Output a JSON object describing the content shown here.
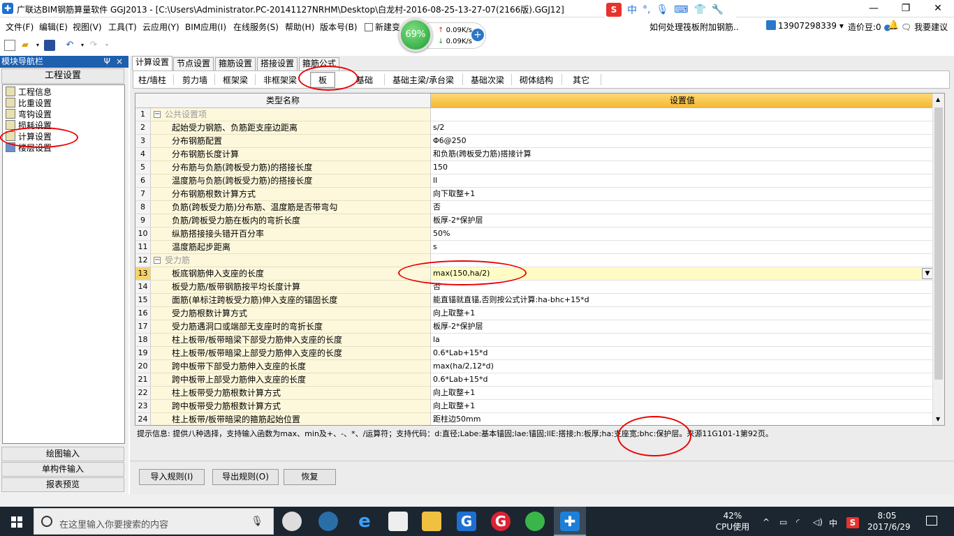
{
  "window": {
    "title": "广联达BIM钢筋算量软件 GGJ2013 - [C:\\Users\\Administrator.PC-20141127NRHM\\Desktop\\白龙村-2016-08-25-13-27-07(2166版).GGJ12]",
    "minimize": "—",
    "restore": "❐",
    "close": "✕"
  },
  "ime_bar": {
    "logo": "S",
    "mode": "中",
    "punct": "°,",
    "voice": "🎙",
    "keyboard": "⌨",
    "skin": "👕",
    "tools": "🔧"
  },
  "menu": [
    "文件(F)",
    "编辑(E)",
    "视图(V)",
    "工具(T)",
    "云应用(Y)",
    "BIM应用(I)",
    "在线服务(S)",
    "帮助(H)",
    "版本号(B)",
    "新建变"
  ],
  "news_link": "如何处理筏板附加钢筋..",
  "user": {
    "phone": "13907298339",
    "beans_label": "造价豆:0",
    "suggest": "我要建议"
  },
  "net_monitor": {
    "percent": "69%",
    "up": "0.09K/s",
    "down": "0.09K/s",
    "plus": "+"
  },
  "left_nav": {
    "header": "模块导航栏",
    "pin": "Ψ",
    "close": "×",
    "section": "工程设置",
    "items": [
      "工程信息",
      "比重设置",
      "弯钩设置",
      "损耗设置",
      "计算设置",
      "楼层设置"
    ],
    "bottom": [
      "绘图输入",
      "单构件输入",
      "报表预览"
    ]
  },
  "tabs": [
    "计算设置",
    "节点设置",
    "箍筋设置",
    "搭接设置",
    "箍筋公式"
  ],
  "subtabs": [
    "柱/墙柱",
    "剪力墙",
    "框架梁",
    "非框架梁",
    "板",
    "基础",
    "基础主梁/承台梁",
    "基础次梁",
    "砌体结构",
    "其它"
  ],
  "grid": {
    "col_name": "类型名称",
    "col_value": "设置值",
    "rows": [
      {
        "no": "1",
        "name": "公共设置项",
        "value": "",
        "group": true
      },
      {
        "no": "2",
        "name": "起始受力钢筋、负筋距支座边距离",
        "value": "s/2"
      },
      {
        "no": "3",
        "name": "分布钢筋配置",
        "value": "Φ6@250"
      },
      {
        "no": "4",
        "name": "分布钢筋长度计算",
        "value": "和负筋(跨板受力筋)搭接计算"
      },
      {
        "no": "5",
        "name": "分布筋与负筋(跨板受力筋)的搭接长度",
        "value": "150"
      },
      {
        "no": "6",
        "name": "温度筋与负筋(跨板受力筋)的搭接长度",
        "value": "ll"
      },
      {
        "no": "7",
        "name": "分布钢筋根数计算方式",
        "value": "向下取整+1"
      },
      {
        "no": "8",
        "name": "负筋(跨板受力筋)分布筋、温度筋是否带弯勾",
        "value": "否"
      },
      {
        "no": "9",
        "name": "负筋/跨板受力筋在板内的弯折长度",
        "value": "板厚-2*保护层"
      },
      {
        "no": "10",
        "name": "纵筋搭接接头错开百分率",
        "value": "50%"
      },
      {
        "no": "11",
        "name": "温度筋起步距离",
        "value": "s"
      },
      {
        "no": "12",
        "name": "受力筋",
        "value": "",
        "group": true
      },
      {
        "no": "13",
        "name": "板底钢筋伸入支座的长度",
        "value": "max(150,ha/2)",
        "selected": true
      },
      {
        "no": "14",
        "name": "板受力筋/板带钢筋按平均长度计算",
        "value": "否"
      },
      {
        "no": "15",
        "name": "面筋(单标注跨板受力筋)伸入支座的锚固长度",
        "value": "能直锚就直锚,否则按公式计算:ha-bhc+15*d"
      },
      {
        "no": "16",
        "name": "受力筋根数计算方式",
        "value": "向上取整+1"
      },
      {
        "no": "17",
        "name": "受力筋遇洞口或端部无支座时的弯折长度",
        "value": "板厚-2*保护层"
      },
      {
        "no": "18",
        "name": "柱上板带/板带暗梁下部受力筋伸入支座的长度",
        "value": "la"
      },
      {
        "no": "19",
        "name": "柱上板带/板带暗梁上部受力筋伸入支座的长度",
        "value": "0.6*Lab+15*d"
      },
      {
        "no": "20",
        "name": "跨中板带下部受力筋伸入支座的长度",
        "value": "max(ha/2,12*d)"
      },
      {
        "no": "21",
        "name": "跨中板带上部受力筋伸入支座的长度",
        "value": "0.6*Lab+15*d"
      },
      {
        "no": "22",
        "name": "柱上板带受力筋根数计算方式",
        "value": "向上取整+1"
      },
      {
        "no": "23",
        "name": "跨中板带受力筋根数计算方式",
        "value": "向上取整+1"
      },
      {
        "no": "24",
        "name": "柱上板带/板带暗梁的箍筋起始位置",
        "value": "距柱边50mm"
      }
    ]
  },
  "hint": "提示信息: 提供八种选择，支持输入函数为max、min及+、-、*、/运算符；支持代码：d:直径;Labe:基本锚固;lae:锚固;llE:搭接;h:板厚;ha:支座宽;bhc:保护层。来源11G101-1第92页。",
  "buttons": {
    "import": "导入规则(I)",
    "export": "导出规则(O)",
    "restore": "恢复"
  },
  "taskbar": {
    "search_placeholder": "在这里输入你要搜索的内容",
    "cpu_percent": "42%",
    "cpu_label": "CPU使用",
    "tray_ime": "中",
    "time": "8:05",
    "date": "2017/6/29"
  },
  "colors": {
    "accent": "#1e5fae",
    "header_orange": "#f4b833",
    "annotation_red": "#e00000"
  }
}
